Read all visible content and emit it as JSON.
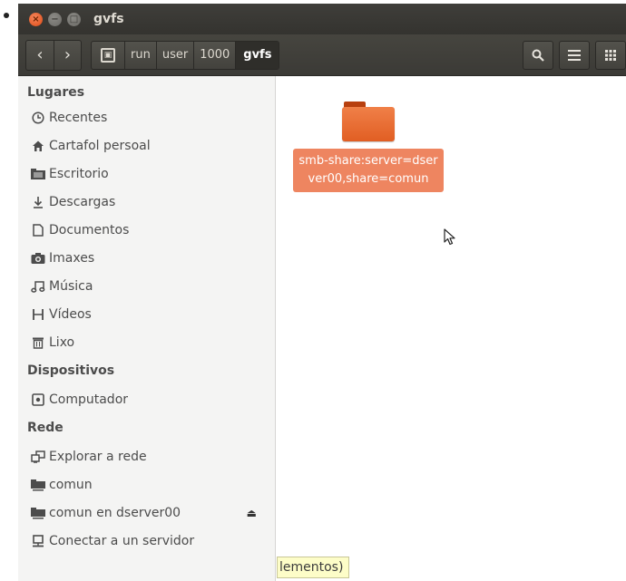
{
  "window": {
    "title": "gvfs"
  },
  "toolbar": {
    "breadcrumbs": [
      "run",
      "user",
      "1000",
      "gvfs"
    ]
  },
  "sidebar": {
    "sections": [
      {
        "label": "Lugares",
        "items": [
          {
            "label": "Recentes",
            "icon": "clock-icon"
          },
          {
            "label": "Cartafol persoal",
            "icon": "home-icon"
          },
          {
            "label": "Escritorio",
            "icon": "desktop-folder-icon"
          },
          {
            "label": "Descargas",
            "icon": "download-icon"
          },
          {
            "label": "Documentos",
            "icon": "document-icon"
          },
          {
            "label": "Imaxes",
            "icon": "camera-icon"
          },
          {
            "label": "Música",
            "icon": "music-icon"
          },
          {
            "label": "Vídeos",
            "icon": "film-icon"
          },
          {
            "label": "Lixo",
            "icon": "trash-icon"
          }
        ]
      },
      {
        "label": "Dispositivos",
        "items": [
          {
            "label": "Computador",
            "icon": "drive-icon"
          }
        ]
      },
      {
        "label": "Rede",
        "items": [
          {
            "label": "Explorar a rede",
            "icon": "network-icon"
          },
          {
            "label": "comun",
            "icon": "network-folder-icon"
          },
          {
            "label": "comun en dserver00",
            "icon": "network-folder-icon"
          },
          {
            "label": "Conectar a un servidor",
            "icon": "server-icon"
          }
        ]
      }
    ]
  },
  "main": {
    "files": [
      {
        "name": "smb-share:server=dserver00,share=comun",
        "icon": "folder-icon"
      }
    ]
  },
  "statusbar": {
    "text": "lementos)"
  },
  "colors": {
    "accent": "#e15e23",
    "selection": "#ee8560",
    "titlebar": "#3c3b37",
    "statusbar": "#fdfdc8"
  }
}
